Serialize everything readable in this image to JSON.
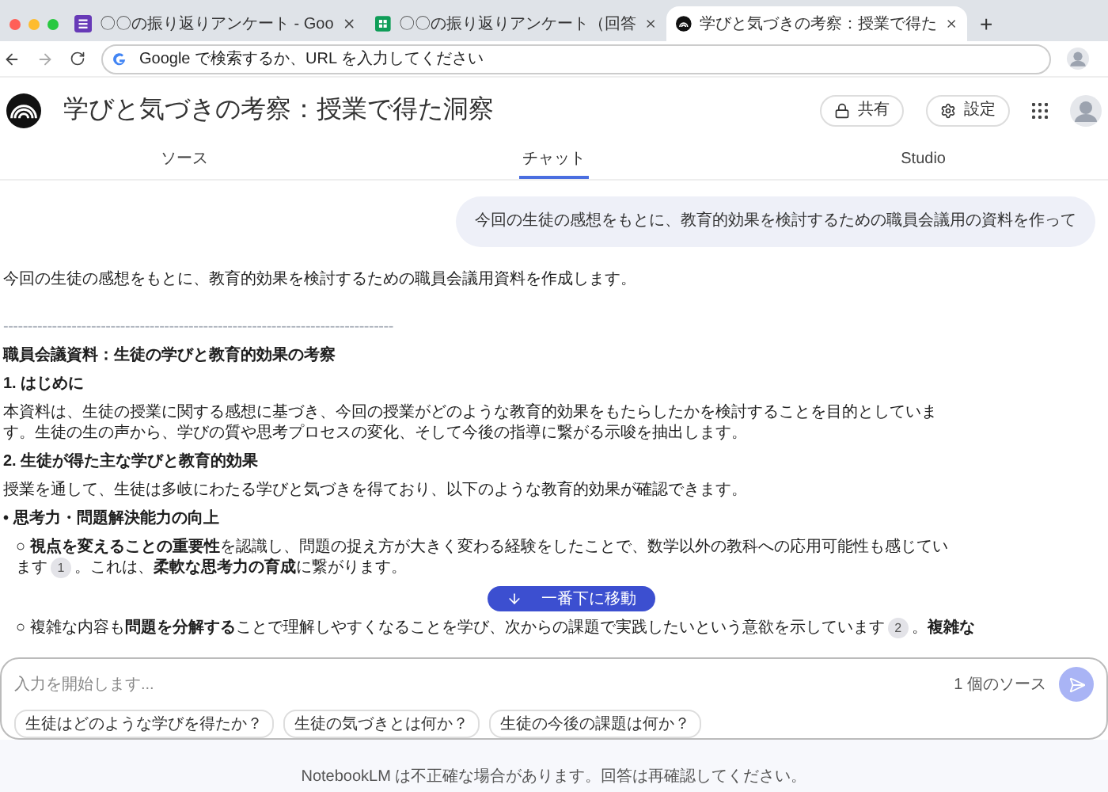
{
  "browser": {
    "tabs": [
      {
        "title": "〇〇の振り返りアンケート - Goo",
        "kind": "forms",
        "selected": false
      },
      {
        "title": "〇〇の振り返りアンケート（回答",
        "kind": "sheets",
        "selected": false
      },
      {
        "title": "学びと気づきの考察：授業で得た",
        "kind": "notebook",
        "selected": true
      }
    ],
    "new_tab": "+",
    "address_placeholder": "Google で検索するか、URL を入力してください"
  },
  "header": {
    "title": "学びと気づきの考察：授業で得た洞察",
    "share": "共有",
    "settings": "設定"
  },
  "panel_tabs": [
    {
      "label": "ソース",
      "selected": false
    },
    {
      "label": "チャット",
      "selected": true
    },
    {
      "label": "Studio",
      "selected": false
    }
  ],
  "chat": {
    "user_message": "今回の生徒の感想をもとに、教育的効果を検討するための職員会議用の資料を作って",
    "response": [
      {
        "kind": "text",
        "parts": [
          {
            "text": "今回の生徒の感想をもとに、教育的効果を検討するための職員会議用資料を作成します。"
          }
        ]
      },
      {
        "kind": "divider",
        "parts": [
          {
            "text": "--------------------------------------------------------------------------------"
          }
        ]
      },
      {
        "kind": "heading",
        "parts": [
          {
            "text": "職員会議資料：生徒の学びと教育的効果の考察"
          }
        ]
      },
      {
        "kind": "heading",
        "parts": [
          {
            "text": "1. はじめに"
          }
        ]
      },
      {
        "kind": "text",
        "parts": [
          {
            "text": "本資料は、生徒の授業に関する感想に基づき、今回の授業がどのような教育的効果をもたらしたかを検討することを目的としています。生徒の生の声から、学びの質や思考プロセスの変化、そして今後の指導に繋がる示唆を抽出します。"
          }
        ]
      },
      {
        "kind": "heading",
        "parts": [
          {
            "text": "2. 生徒が得た主な学びと教育的効果"
          }
        ]
      },
      {
        "kind": "text",
        "parts": [
          {
            "text": "授業を通して、生徒は多岐にわたる学びと気づきを得ており、以下のような教育的効果が確認できます。"
          }
        ]
      },
      {
        "kind": "bullet",
        "parts": [
          {
            "text": "• 思考力・問題解決能力の向上"
          }
        ]
      },
      {
        "kind": "subbullet",
        "parts": [
          {
            "text": "○ **視点を変えることの重要性**を認識し、問題の捉え方が大きく変わる経験をしたことで、数学以外の教科への応用可能性も感じています"
          },
          {
            "citation": "1"
          },
          {
            "text": "。これは、**柔軟な思考力の育成**に繋がります。"
          }
        ]
      },
      {
        "kind": "subbullet",
        "parts": [
          {
            "text": "○ 複雑な内容も**問題を分解する**ことで理解しやすくなることを学び、次からの課題で実践したいという意欲を示しています"
          },
          {
            "citation": "2"
          },
          {
            "text": "。**複雑な**"
          }
        ]
      }
    ],
    "scroll_button": "一番下に移動"
  },
  "composer": {
    "placeholder": "入力を開始します...",
    "source_count": "1 個のソース",
    "suggestions": [
      "生徒はどのような学びを得たか？",
      "生徒の気づきとは何か？",
      "生徒の今後の課題は何か？"
    ]
  },
  "footer": "NotebookLM は不正確な場合があります。回答は再確認してください。"
}
